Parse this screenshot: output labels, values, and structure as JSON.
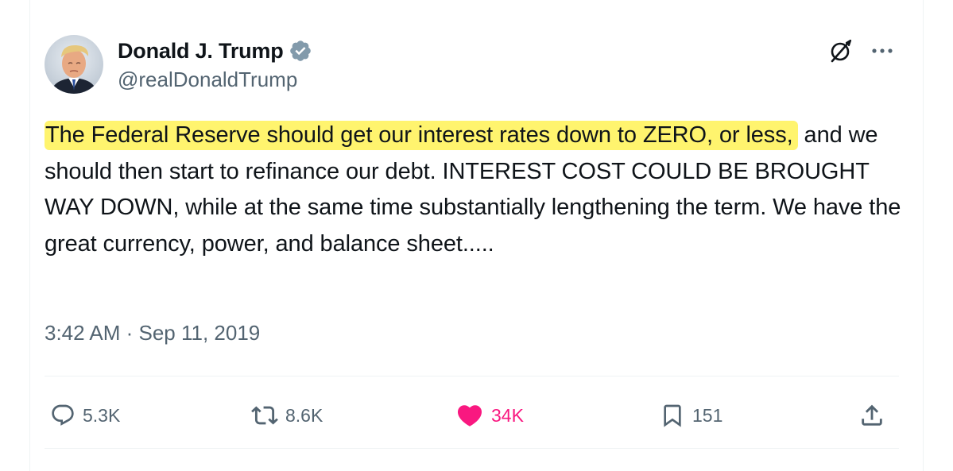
{
  "tweet": {
    "author": {
      "display_name": "Donald J. Trump",
      "handle": "@realDonaldTrump",
      "verified": true,
      "avatar_icon": "user-avatar-portrait"
    },
    "text": {
      "highlighted": "The Federal Reserve should get our interest rates down to ZERO, or less,",
      "rest": " and we should then start to refinance our debt. INTEREST COST COULD BE BROUGHT WAY DOWN, while at the same time substantially lengthening the term. We have the great currency, power, and balance sheet....."
    },
    "timestamp": "3:42 AM · Sep 11, 2019",
    "actions": {
      "reply": {
        "icon": "reply-icon",
        "count": "5.3K"
      },
      "retweet": {
        "icon": "retweet-icon",
        "count": "8.6K"
      },
      "like": {
        "icon": "heart-icon",
        "count": "34K",
        "active": true
      },
      "bookmark": {
        "icon": "bookmark-icon",
        "count": "151"
      },
      "share": {
        "icon": "share-icon"
      }
    },
    "top_right": {
      "grok": {
        "icon": "grok-icon"
      },
      "more": {
        "icon": "more-icon"
      }
    }
  },
  "colors": {
    "text_primary": "#0f1419",
    "text_secondary": "#536471",
    "verified_badge": "#829aab",
    "like_active": "#f91880",
    "highlight": "#fff46e",
    "divider": "#eff3f4"
  }
}
